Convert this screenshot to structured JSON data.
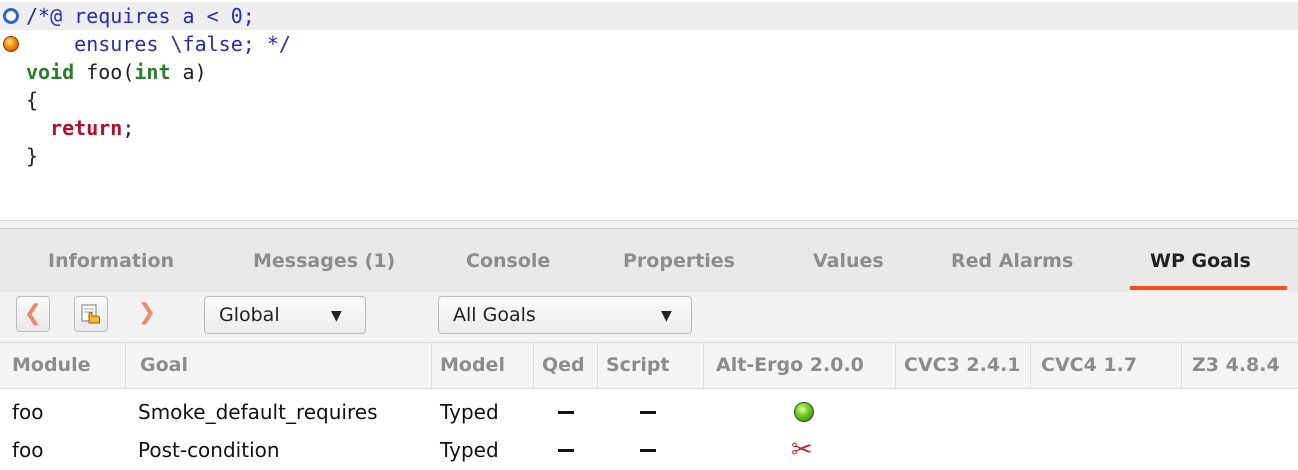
{
  "code": {
    "lines": [
      "/*@ requires a < 0;",
      "    ensures \\false; */",
      "void",
      " foo(",
      "int",
      " a)",
      "{",
      "  return",
      ";",
      "}"
    ]
  },
  "tabs": [
    {
      "label": "Information"
    },
    {
      "label": "Messages (1)"
    },
    {
      "label": "Console"
    },
    {
      "label": "Properties"
    },
    {
      "label": "Values"
    },
    {
      "label": "Red Alarms"
    },
    {
      "label": "WP Goals"
    }
  ],
  "active_tab": "WP Goals",
  "toolbar": {
    "back_icon": "chevron-left-icon",
    "focus_icon": "hand-cursor-icon",
    "forward_icon": "chevron-right-icon",
    "scope_value": "Global",
    "filter_value": "All Goals"
  },
  "table": {
    "headers": [
      "Module",
      "Goal",
      "Model",
      "Qed",
      "Script",
      "Alt-Ergo 2.0.0",
      "CVC3 2.4.1",
      "CVC4 1.7",
      "Z3 4.8.4"
    ],
    "rows": [
      {
        "module": "foo",
        "goal": "Smoke_default_requires",
        "model": "Typed",
        "qed": "—",
        "script": "—",
        "alt_ergo_status": "valid-green-icon"
      },
      {
        "module": "foo",
        "goal": "Post-condition",
        "model": "Typed",
        "qed": "—",
        "script": "—",
        "alt_ergo_status": "failed-scissors-icon"
      }
    ]
  },
  "colors": {
    "accent": "#e9531c",
    "comment": "#2a2ab4",
    "keyword": "#2a7d2a",
    "return_keyword": "#b0122b"
  }
}
